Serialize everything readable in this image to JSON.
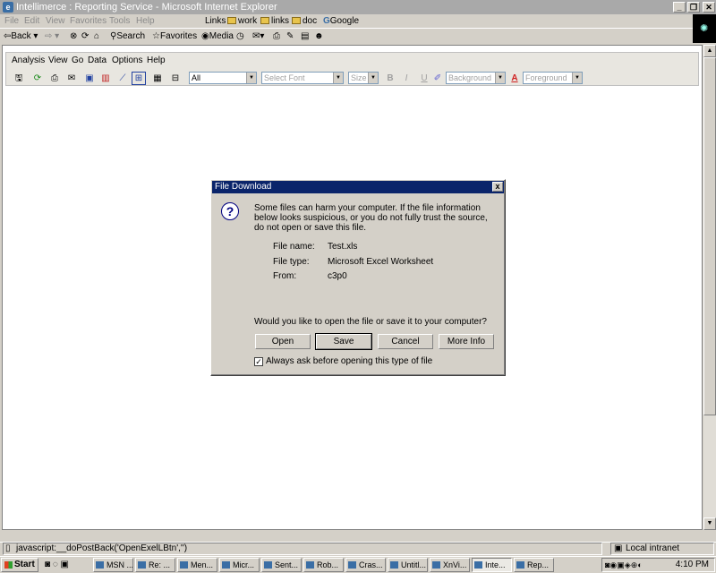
{
  "window": {
    "title": "Intellimerce : Reporting Service - Microsoft Internet Explorer",
    "min": "_",
    "restore": "❐",
    "close": "✕"
  },
  "menu": [
    "File",
    "Edit",
    "View",
    "Favorites",
    "Tools",
    "Help"
  ],
  "links": {
    "label": "Links",
    "items": [
      "work",
      "links",
      "doc"
    ],
    "google": "Google"
  },
  "toolbar": {
    "back": "Back",
    "search": "Search",
    "favorites": "Favorites",
    "media": "Media"
  },
  "report_menu": [
    "Analysis",
    "View",
    "Go",
    "Data",
    "Options",
    "Help"
  ],
  "report_toolbar": {
    "icons": [
      "save-icon",
      "refresh-icon",
      "print-icon",
      "email-icon",
      "export-icon",
      "chart-icon",
      "line-chart-icon",
      "properties-icon",
      "table-icon",
      "filter-icon"
    ],
    "scope_value": "All",
    "font_placeholder": "Select Font",
    "size_placeholder": "Size",
    "bold": "B",
    "italic": "I",
    "underline": "U",
    "background": "Background",
    "foreground_glyph": "A",
    "foreground": "Foreground"
  },
  "dialog": {
    "title": "File Download",
    "close": "x",
    "message": "Some files can harm your computer. If the file information below looks suspicious, or you do not fully trust the source, do not open or save this file.",
    "fields": [
      {
        "label": "File name:",
        "value": "Test.xls"
      },
      {
        "label": "File type:",
        "value": "Microsoft Excel Worksheet"
      },
      {
        "label": "From:",
        "value": "c3p0"
      }
    ],
    "question": "Would you like to open the file or save it to your computer?",
    "buttons": [
      "Open",
      "Save",
      "Cancel",
      "More Info"
    ],
    "checkbox_label": "Always ask before opening this type of file",
    "checkbox_checked": true
  },
  "status": {
    "text": "javascript:__doPostBack('OpenExelLBtn','')",
    "zone": "Local intranet"
  },
  "taskbar": {
    "start": "Start",
    "tasks": [
      "MSN ...",
      "Re: ...",
      "Men...",
      "Micr...",
      "Sent...",
      "Rob...",
      "Cras...",
      "Untitl...",
      "XnVi...",
      "Inte...",
      "Rep..."
    ],
    "time": "4:10 PM"
  }
}
